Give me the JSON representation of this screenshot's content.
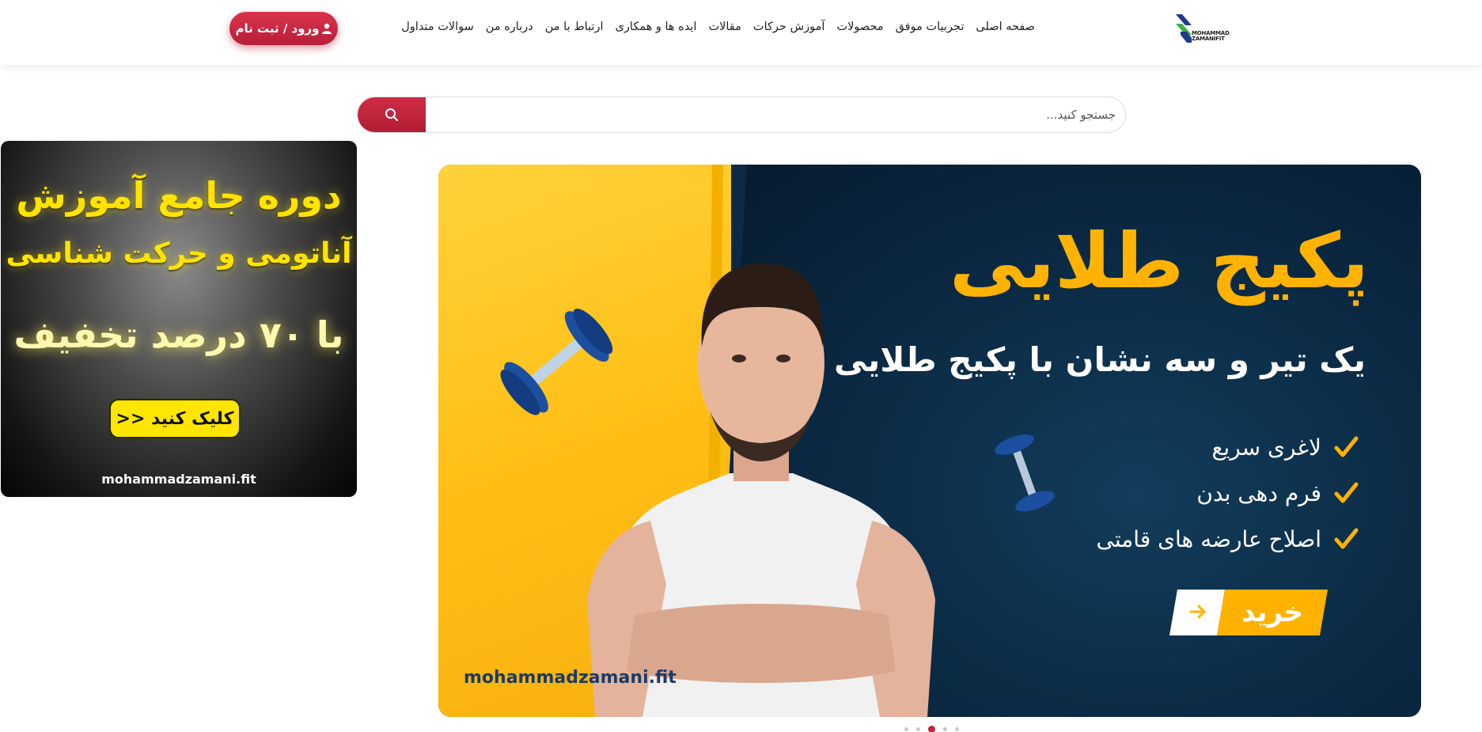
{
  "header": {
    "logo_text_line1": "MOHAMMAD",
    "logo_text_line2": "ZAMANIFIT",
    "nav": [
      {
        "label": "صفحه اصلی"
      },
      {
        "label": "تجربیات موفق"
      },
      {
        "label": "محصولات"
      },
      {
        "label": "آموزش حرکات"
      },
      {
        "label": "مقالات"
      },
      {
        "label": "ایده ها و همکاری"
      },
      {
        "label": "ارتباط با من"
      },
      {
        "label": "درباره من"
      },
      {
        "label": "سوالات متداول"
      }
    ],
    "login_label": "ورود / ثبت نام",
    "login_icon": "user-icon",
    "accent_color": "#c1243c"
  },
  "search": {
    "placeholder": "جستجو کنید...",
    "value": "",
    "icon": "search-icon"
  },
  "side_banner": {
    "line1": "دوره جامع آموزش",
    "line2": "آناتومی و حرکت شناسی",
    "line3": "با ۷۰ درصد تخفیف",
    "cta": "کلیک کنید <<",
    "url": "mohammadzamani.fit"
  },
  "slider": {
    "title": "پکیج طلایی",
    "subtitle": "یک تیر و سه نشان با پکیج طلایی",
    "features": [
      "لاغری سریع",
      "فرم دهی بدن",
      "اصلاح عارضه های قامتی"
    ],
    "buy_label": "خرید",
    "url": "mohammadzamani.fit",
    "colors": {
      "yellow": "#ffb300",
      "dark": "#0b2a44"
    },
    "dots_count": 5,
    "active_dot": 3
  }
}
